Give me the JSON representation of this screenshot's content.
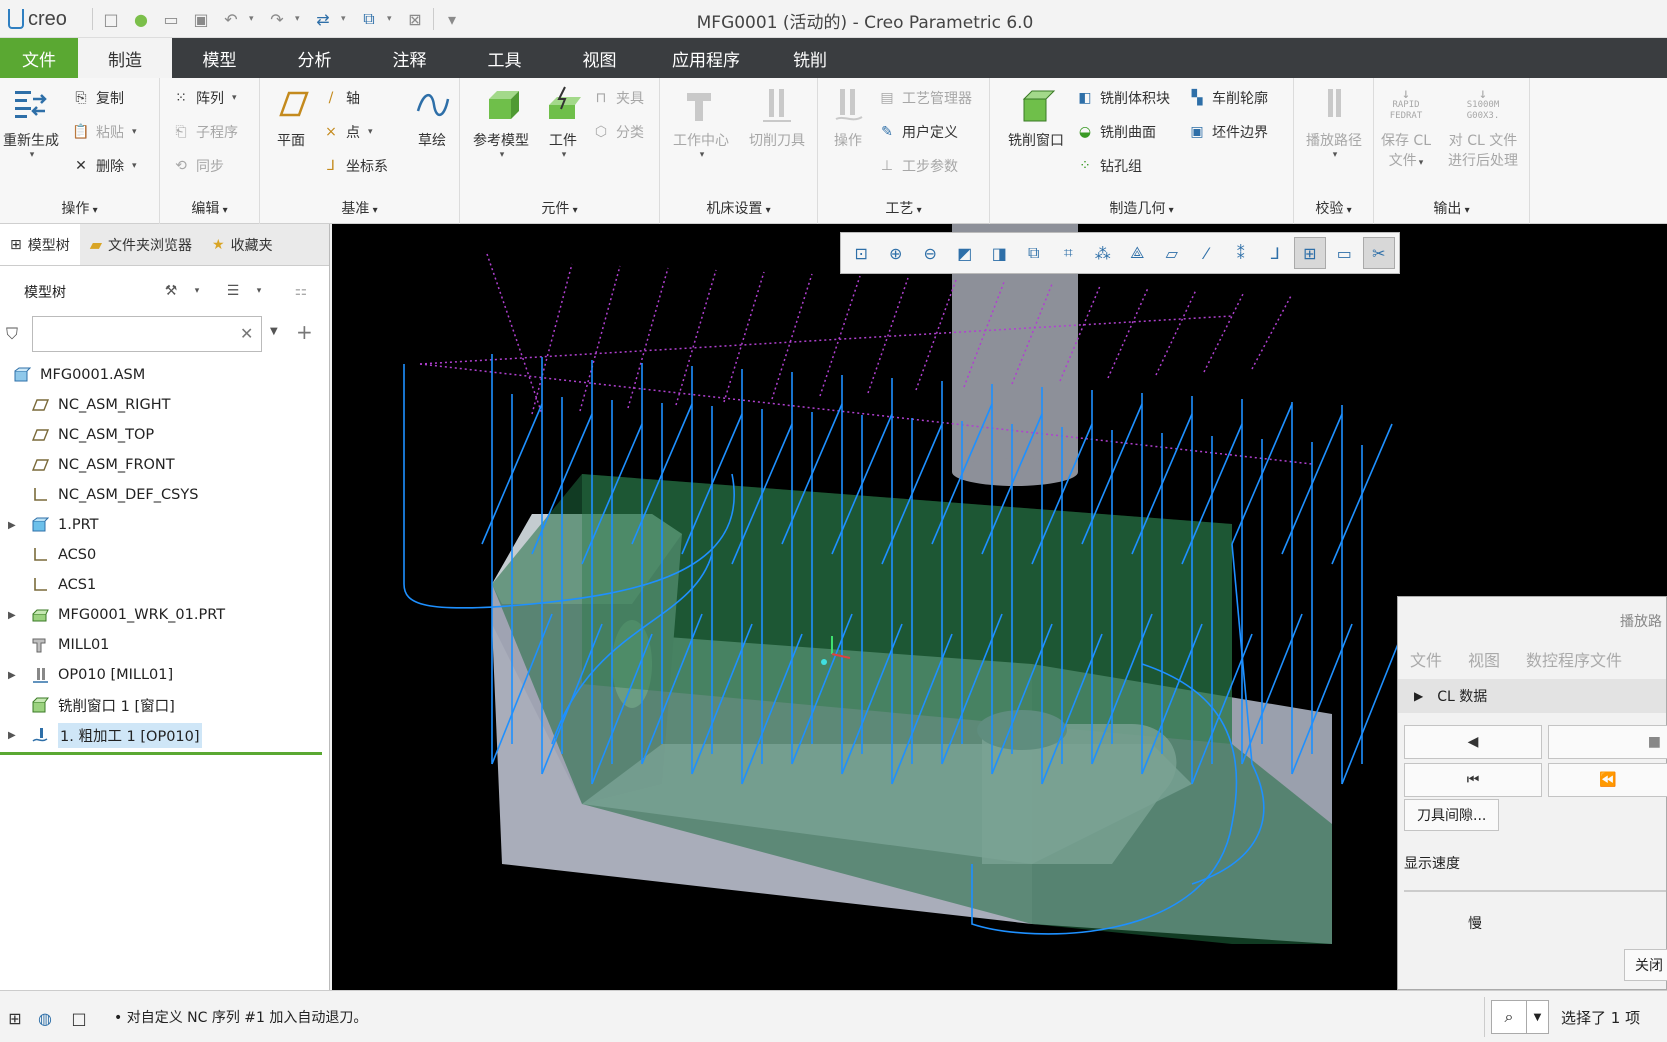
{
  "window": {
    "title": "MFG0001 (活动的) - Creo Parametric 6.0",
    "logo": "creo"
  },
  "tabs": [
    "文件",
    "制造",
    "模型",
    "分析",
    "注释",
    "工具",
    "视图",
    "应用程序",
    "铣削"
  ],
  "active_tab": "制造",
  "ribbon": {
    "groups": {
      "operations": "操作",
      "edit": "编辑",
      "datum": "基准",
      "components": "元件",
      "machine": "机床设置",
      "process": "工艺",
      "mfg_geometry": "制造几何",
      "verify": "校验",
      "output": "输出"
    },
    "buttons": {
      "regenerate": "重新生成",
      "copy": "复制",
      "paste": "粘贴",
      "delete": "删除",
      "pattern": "阵列",
      "subroutine": "子程序",
      "sync": "同步",
      "plane": "平面",
      "axis": "轴",
      "point": "点",
      "csys": "坐标系",
      "sketch": "草绘",
      "ref_model": "参考模型",
      "workpiece": "工件",
      "fixture": "夹具",
      "classify": "分类",
      "work_center": "工作中心",
      "cutting_tool": "切削刀具",
      "operation": "操作",
      "process_mgr": "工艺管理器",
      "user_defined": "用户定义",
      "step_params": "工步参数",
      "mill_window": "铣削窗口",
      "mill_volume": "铣削体积块",
      "mill_surface": "铣削曲面",
      "drill_group": "钻孔组",
      "turn_profile": "车削轮廓",
      "stock_boundary": "坯件边界",
      "play_path": "播放路径",
      "save_cl_1": "保存 CL",
      "save_cl_2": "文件",
      "post_cl_1": "对 CL 文件",
      "post_cl_2": "进行后处理",
      "rapid_icon_1": "RAPID",
      "rapid_icon_2": "FEDRAT",
      "post_icon_1": "S1000M",
      "post_icon_2": "G00X3."
    }
  },
  "left_panel": {
    "tabs": [
      "模型树",
      "文件夹浏览器",
      "收藏夹"
    ],
    "model_tree_title": "模型树",
    "search_value": "",
    "tree": [
      {
        "label": "MFG0001.ASM",
        "icon": "assembly-icon",
        "expandable": false,
        "root": true
      },
      {
        "label": "NC_ASM_RIGHT",
        "icon": "datum-plane-icon",
        "expandable": false
      },
      {
        "label": "NC_ASM_TOP",
        "icon": "datum-plane-icon",
        "expandable": false
      },
      {
        "label": "NC_ASM_FRONT",
        "icon": "datum-plane-icon",
        "expandable": false
      },
      {
        "label": "NC_ASM_DEF_CSYS",
        "icon": "csys-icon",
        "expandable": false
      },
      {
        "label": "1.PRT",
        "icon": "part-icon",
        "expandable": true
      },
      {
        "label": "ACS0",
        "icon": "csys-icon",
        "expandable": false
      },
      {
        "label": "ACS1",
        "icon": "csys-icon",
        "expandable": false
      },
      {
        "label": "MFG0001_WRK_01.PRT",
        "icon": "workpiece-icon",
        "expandable": true
      },
      {
        "label": "MILL01",
        "icon": "mill-icon",
        "expandable": false
      },
      {
        "label": "OP010 [MILL01]",
        "icon": "operation-icon",
        "expandable": true
      },
      {
        "label": "铣削窗口 1 [窗口]",
        "icon": "mill-window-icon",
        "expandable": false
      },
      {
        "label": "1. 粗加工 1 [OP010]",
        "icon": "roughing-icon",
        "expandable": true,
        "selected": true
      }
    ]
  },
  "playback": {
    "title": "播放路",
    "menu": [
      "文件",
      "视图",
      "数控程序文件"
    ],
    "cl_data": "CL 数据",
    "tool_clearance": "刀具间隙...",
    "display_speed": "显示速度",
    "slow": "慢",
    "close": "关闭"
  },
  "status": {
    "message": "• 对自定义 NC 序列 #1 加入自动退刀。",
    "selection": "选择了 1 项"
  },
  "colors": {
    "file_tab": "#5aa832",
    "tab_bar": "#3a3d40",
    "viewport": "#000000",
    "toolpath": "#1e90ff",
    "rapid_path": "#b040d0",
    "workpiece": "#1f6b3f"
  }
}
